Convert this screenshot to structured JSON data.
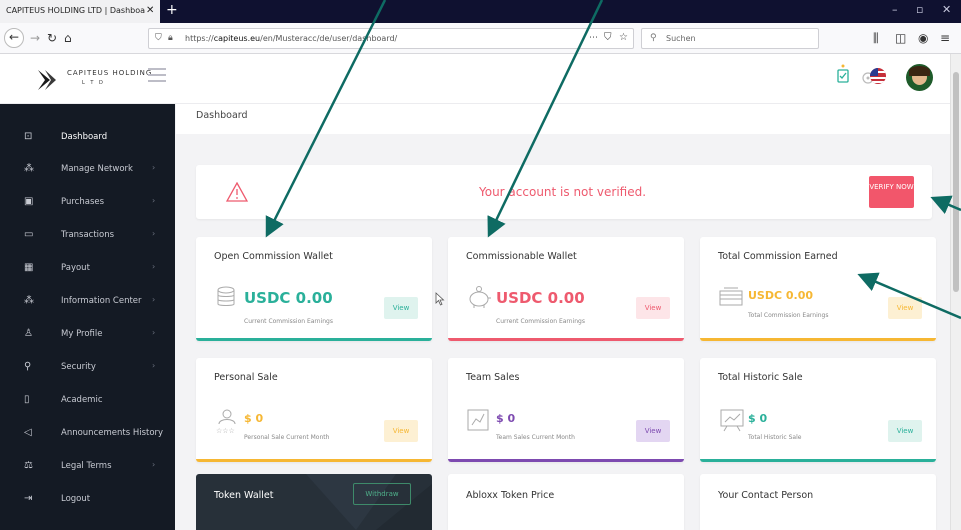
{
  "browser": {
    "tab_title": "CAPITEUS HOLDING LTD | Dashboa",
    "tab_close": "✕",
    "new_tab": "+",
    "url_prefix": "https://",
    "url_host": "capiteus.eu",
    "url_path": "/en/Musteracc/de/user/dashboard/",
    "search_placeholder": "Suchen",
    "window_controls": [
      "–",
      "▫",
      "✕"
    ]
  },
  "header": {
    "brand_name": "CAPITEUS HOLDING",
    "brand_sub": "L T D"
  },
  "sidebar": {
    "items": [
      {
        "label": "Dashboard",
        "icon": "dashboard-icon",
        "glyph": "⊡",
        "has_chevron": false
      },
      {
        "label": "Manage Network",
        "icon": "network-icon",
        "glyph": "⁂",
        "has_chevron": true
      },
      {
        "label": "Purchases",
        "icon": "purchases-icon",
        "glyph": "▣",
        "has_chevron": true
      },
      {
        "label": "Transactions",
        "icon": "transactions-icon",
        "glyph": "▭",
        "has_chevron": true
      },
      {
        "label": "Payout",
        "icon": "payout-icon",
        "glyph": "▦",
        "has_chevron": true
      },
      {
        "label": "Information Center",
        "icon": "information-icon",
        "glyph": "⁂",
        "has_chevron": true
      },
      {
        "label": "My Profile",
        "icon": "profile-icon",
        "glyph": "♙",
        "has_chevron": true
      },
      {
        "label": "Security",
        "icon": "security-icon",
        "glyph": "⚲",
        "has_chevron": true
      },
      {
        "label": "Academic",
        "icon": "academic-icon",
        "glyph": "▯",
        "has_chevron": false
      },
      {
        "label": "Announcements History",
        "icon": "megaphone-icon",
        "glyph": "◁",
        "has_chevron": false
      },
      {
        "label": "Legal Terms",
        "icon": "legal-icon",
        "glyph": "⚖",
        "has_chevron": true
      },
      {
        "label": "Logout",
        "icon": "logout-icon",
        "glyph": "⇥",
        "has_chevron": false
      }
    ],
    "chevron": "›"
  },
  "main": {
    "page_title": "Dashboard",
    "alert": {
      "message": "Your account is not verified.",
      "button": "VERIFY NOW"
    },
    "cards": [
      {
        "title": "Open Commission Wallet",
        "amount": "USDC 0.00",
        "sub": "Current Commission Earnings",
        "view": "View"
      },
      {
        "title": "Commissionable Wallet",
        "amount": "USDC 0.00",
        "sub": "Current Commission Earnings",
        "view": "View"
      },
      {
        "title": "Total Commission Earned",
        "amount": "USDC 0.00",
        "sub": "Total Commission Earnings",
        "view": "View"
      },
      {
        "title": "Personal Sale",
        "amount": "$ 0",
        "sub": "Personal Sale Current Month",
        "view": "View"
      },
      {
        "title": "Team Sales",
        "amount": "$ 0",
        "sub": "Team Sales Current Month",
        "view": "View"
      },
      {
        "title": "Total Historic Sale",
        "amount": "$ 0",
        "sub": "Total Historic Sale",
        "view": "View"
      }
    ],
    "bottom": {
      "token_wallet": "Token Wallet",
      "withdraw": "Withdraw",
      "token_price": "Abloxx Token Price",
      "contact": "Your Contact Person"
    }
  },
  "colors": {
    "teal": "#2ab09a",
    "red": "#ee5a6e",
    "orange": "#f6b733",
    "purple": "#7d4ab0",
    "arrow": "#0e6b63",
    "sidebar_bg": "#141a24"
  }
}
